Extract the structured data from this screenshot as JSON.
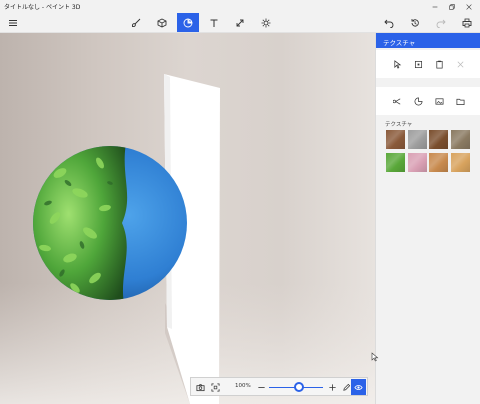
{
  "window": {
    "title": "タイトルなし - ペイント 3D",
    "controls": [
      "minimize-icon",
      "restore-icon",
      "close-icon"
    ]
  },
  "toolbar": {
    "left": [
      "menu-icon"
    ],
    "center": [
      "brushes-icon",
      "3d-shapes-icon",
      "stickers-icon",
      "text-icon",
      "effects-icon",
      "canvas-icon",
      "brightness-icon"
    ],
    "right": [
      "undo-icon",
      "history-icon",
      "redo-icon",
      "print-icon"
    ],
    "active": "stickers-icon"
  },
  "sidepanel": {
    "title": "テクスチャ",
    "section_label": "テクスチャ",
    "top_tools": [
      "select-icon",
      "stamp-icon",
      "paste-icon",
      "delete-icon"
    ],
    "category_tools": [
      "cut-paste-icon",
      "stickers-icon",
      "texture-image-icon",
      "folder-icon"
    ],
    "textures": [
      {
        "name": "bark",
        "color": "#8a5a3a"
      },
      {
        "name": "granite",
        "color": "#9e9e9e"
      },
      {
        "name": "wood-dark",
        "color": "#7a4e2d"
      },
      {
        "name": "stones",
        "color": "#8a7a62"
      },
      {
        "name": "leaves",
        "color": "#5aa83a"
      },
      {
        "name": "pink-flowers",
        "color": "#d9a0b4"
      },
      {
        "name": "wood-light",
        "color": "#c88a4e"
      },
      {
        "name": "cork",
        "color": "#d8a35e"
      }
    ]
  },
  "zoom": {
    "level": "100%",
    "value": 0.55
  },
  "colors": {
    "accent": "#2b62e8"
  }
}
